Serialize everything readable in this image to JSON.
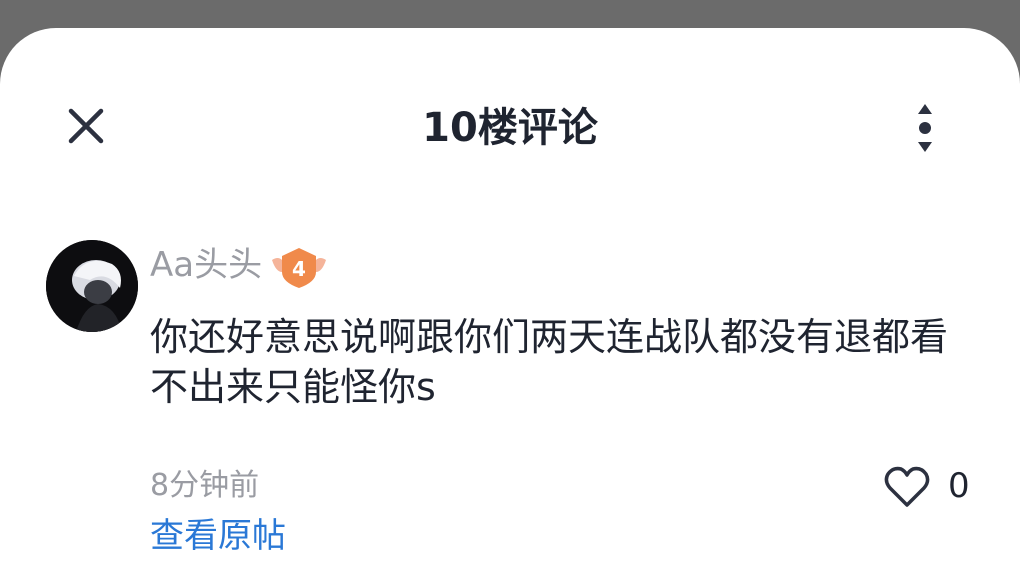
{
  "header": {
    "title": "10楼评论",
    "close_icon": "close-icon",
    "more_icon": "more-vertical-icon"
  },
  "comment": {
    "avatar_icon": "avatar",
    "username": "Aa头头",
    "level": "4",
    "text": "你还好意思说啊跟你们两天连战队都没有退都看不出来只能怪你s",
    "timestamp": "8分钟前",
    "like_count": "0",
    "like_icon": "heart-icon"
  },
  "footer": {
    "view_original_label": "查看原帖"
  },
  "colors": {
    "overlay": "#6b6b6b",
    "sheet": "#ffffff",
    "text_primary": "#1f2430",
    "text_secondary": "#9a9ca3",
    "link": "#2a78d6",
    "badge": "#f08a4b"
  }
}
